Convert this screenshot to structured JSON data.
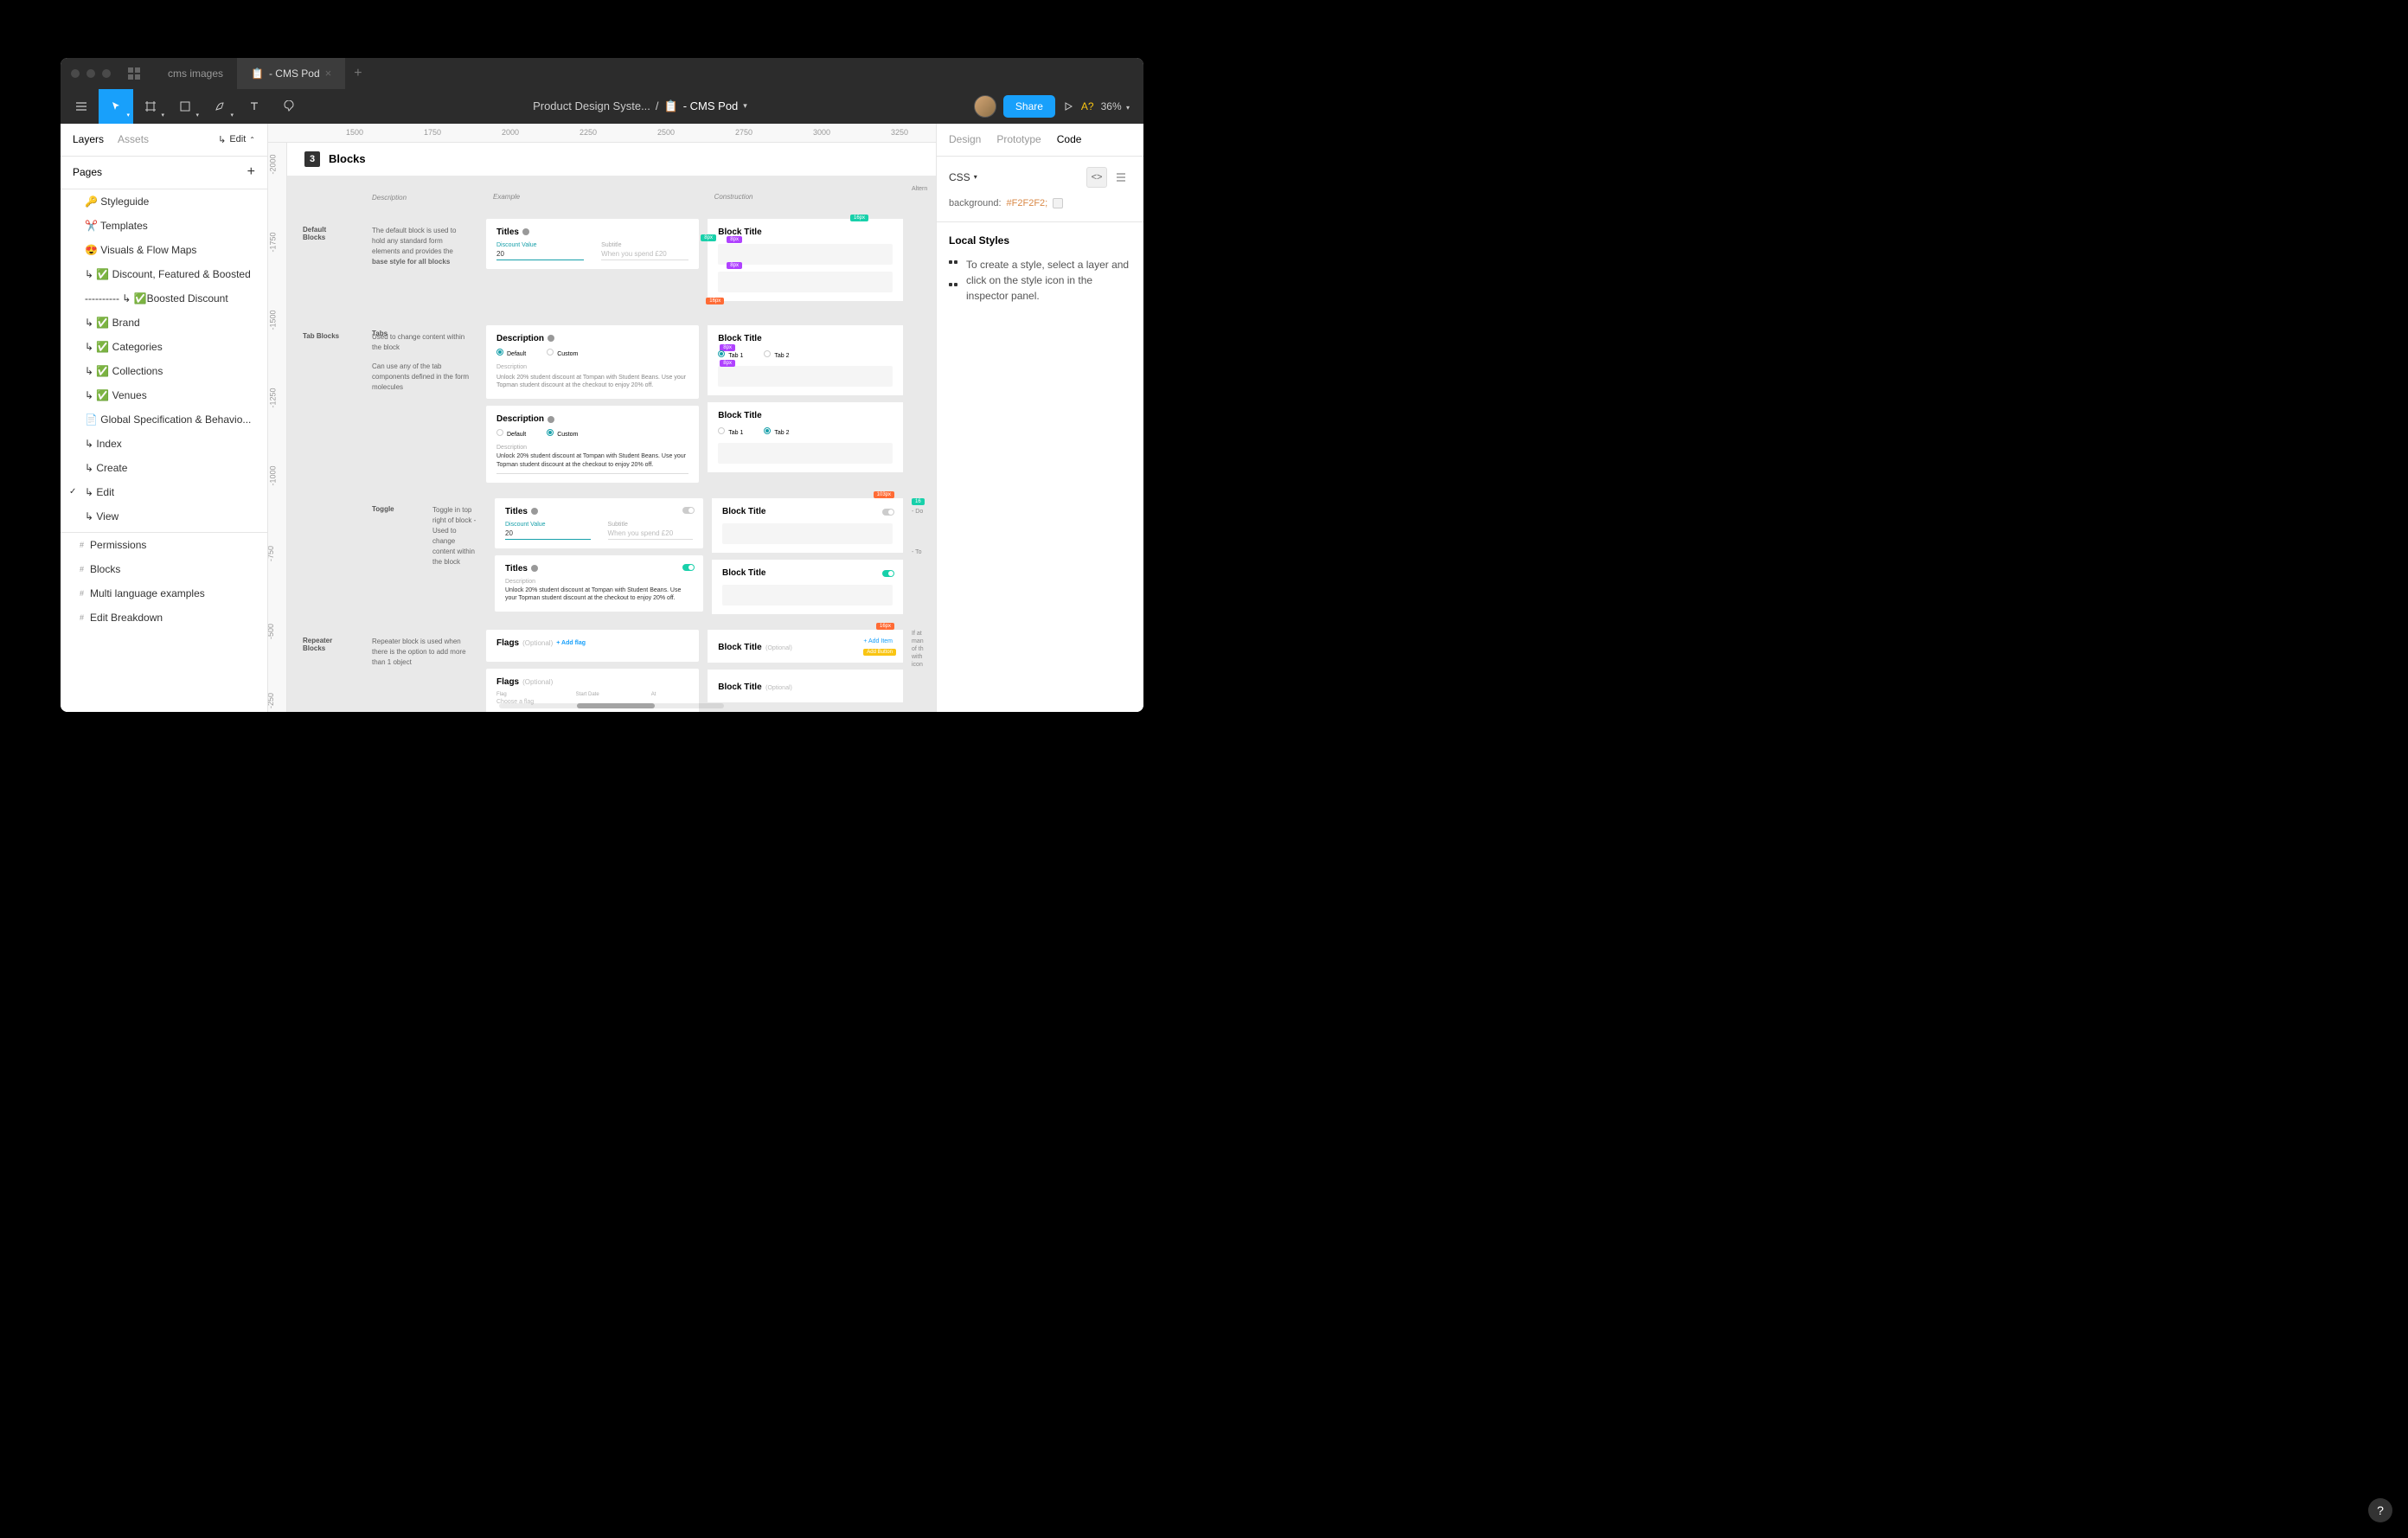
{
  "titlebar": {
    "tab1": "cms images",
    "tab2": "- CMS Pod"
  },
  "toolbar": {
    "breadcrumb1": "Product Design Syste...",
    "breadcrumb2": "- CMS Pod",
    "share": "Share",
    "badge": "A?",
    "zoom": "36%"
  },
  "leftPanel": {
    "tabLayers": "Layers",
    "tabAssets": "Assets",
    "edit": "Edit",
    "pagesTitle": "Pages",
    "pages": [
      "🔑 Styleguide",
      "✂️ Templates",
      "😍 Visuals & Flow Maps",
      "↳ ✅ Discount, Featured & Boosted",
      "---------- ↳ ✅Boosted Discount",
      "↳ ✅ Brand",
      "↳ ✅ Categories",
      "↳ ✅ Collections",
      "↳ ✅ Venues",
      "📄 Global Specification & Behavio...",
      "↳ Index",
      "↳ Create",
      "↳ Edit",
      "↳ View"
    ],
    "frames": [
      "Permissions",
      "Blocks",
      "Multi language examples",
      "Edit Breakdown"
    ]
  },
  "ruler": {
    "h": [
      "1500",
      "1750",
      "2000",
      "2250",
      "2500",
      "2750",
      "3000",
      "3250"
    ],
    "v": [
      "-2000",
      "-1750",
      "-1500",
      "-1250",
      "-1000",
      "-750",
      "-500",
      "-250"
    ]
  },
  "canvas": {
    "sectionNum": "3",
    "sectionTitle": "Blocks",
    "headers": {
      "desc": "Description",
      "example": "Example",
      "construction": "Construction",
      "alt": "Altern"
    },
    "rows": {
      "default": {
        "label": "Default Blocks",
        "desc1": "The default block is used to hold any standard form elements and provides the ",
        "desc2": "base style for all blocks",
        "example": {
          "title": "Titles",
          "fieldLabel": "Discount Value",
          "fieldValue": "20",
          "subLabel": "Subtitle",
          "subPh": "When you spend £20"
        },
        "construction": {
          "title": "Block Title",
          "badge1": "16px",
          "badge2": "8px",
          "badge3": "16px",
          "badge4": "8px"
        }
      },
      "tabs": {
        "label": "Tab Blocks",
        "sub": "Tabs",
        "desc1": "Used to change content within the block",
        "desc2": "Can use any of the tab components defined in the form molecules",
        "example1": {
          "title": "Description",
          "opt1": "Default",
          "opt2": "Custom",
          "descLabel": "Description",
          "descText": "Unlock 20% student discount at Tompan with Student Beans. Use your Topman student discount at the checkout  to enjoy 20% off."
        },
        "example2": {
          "title": "Description",
          "opt1": "Default",
          "opt2": "Custom",
          "descLabel": "Description",
          "descText": "Unlock 20% student discount at Tompan with Student Beans. Use your Topman student discount at the checkout  to enjoy 20% off."
        },
        "construction1": {
          "title": "Block Title",
          "tab1": "Tab 1",
          "tab2": "Tab 2"
        },
        "construction2": {
          "title": "Block Title",
          "tab1": "Tab 1",
          "tab2": "Tab 2"
        }
      },
      "toggle": {
        "label": "Toggle",
        "desc": "Toggle in top right of block - Used to change content within the block",
        "example1": {
          "title": "Titles",
          "fieldLabel": "Discount Value",
          "fieldValue": "20",
          "subLabel": "Subtitle",
          "subPh": "When you spend £20"
        },
        "example2": {
          "title": "Titles",
          "descLabel": "Description",
          "descText": "Unlock 20% student discount at Tompan with Student Beans. Use your Topman student discount at the checkout  to enjoy 20% off."
        },
        "construction1": {
          "title": "Block Title"
        },
        "construction2": {
          "title": "Block Title"
        },
        "altNote": "- Do",
        "altNote2": "- To"
      },
      "repeater": {
        "label": "Repeater Blocks",
        "desc": "Repeater block is used when there is the option to add more than 1 object",
        "example1": {
          "title": "Flags",
          "opt": "(Optional)",
          "addFlag": "+ Add flag"
        },
        "example2": {
          "title": "Flags",
          "opt": "(Optional)",
          "col1": "Flag",
          "col2": "Start Date",
          "col3": "At",
          "ph": "Choose a flag"
        },
        "construction1": {
          "title": "Block Title",
          "opt": "(Optional)",
          "addItem": "+ Add Item",
          "badge": "16px"
        },
        "construction2": {
          "title": "Block Title",
          "opt": "(Optional)"
        },
        "altNote": "If at man of th with icon"
      }
    }
  },
  "rightPanel": {
    "tabDesign": "Design",
    "tabPrototype": "Prototype",
    "tabCode": "Code",
    "cssLabel": "CSS",
    "cssProp": "background:",
    "cssVal": "#F2F2F2;",
    "localStylesTitle": "Local Styles",
    "localStylesText": "To create a style, select a layer and click on the style icon in the inspector panel."
  }
}
